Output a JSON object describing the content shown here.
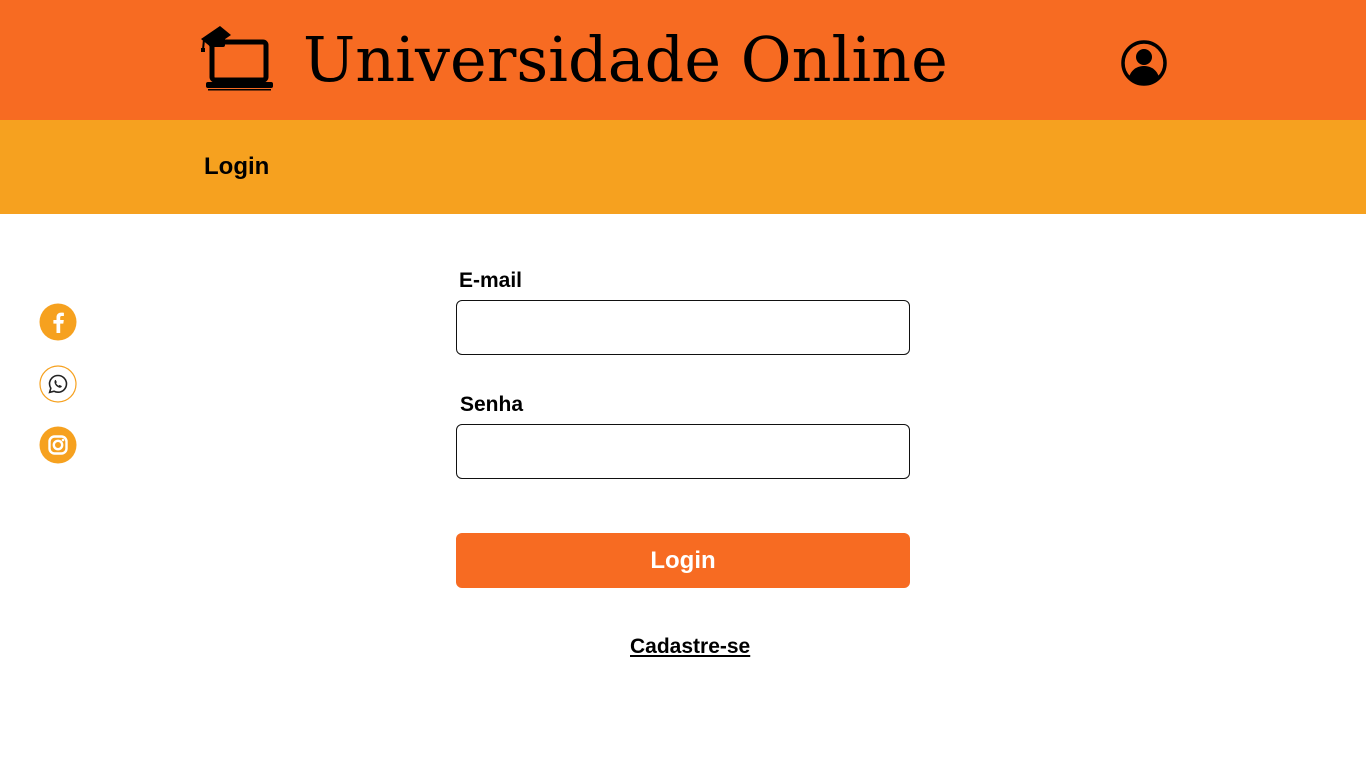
{
  "header": {
    "title": "Universidade Online",
    "logo_icon": "laptop-graduation-cap-icon",
    "user_icon": "user-account-icon",
    "background_color": "#f76b22"
  },
  "subheader": {
    "title": "Login",
    "background_color": "#f6a11f"
  },
  "social": [
    {
      "name": "facebook",
      "icon": "facebook-icon"
    },
    {
      "name": "whatsapp",
      "icon": "whatsapp-icon"
    },
    {
      "name": "instagram",
      "icon": "instagram-icon"
    }
  ],
  "form": {
    "email_label": "E-mail",
    "email_value": "",
    "password_label": "Senha",
    "password_value": "",
    "login_button": "Login",
    "signup_link": "Cadastre-se",
    "accent_color": "#f76b22"
  }
}
